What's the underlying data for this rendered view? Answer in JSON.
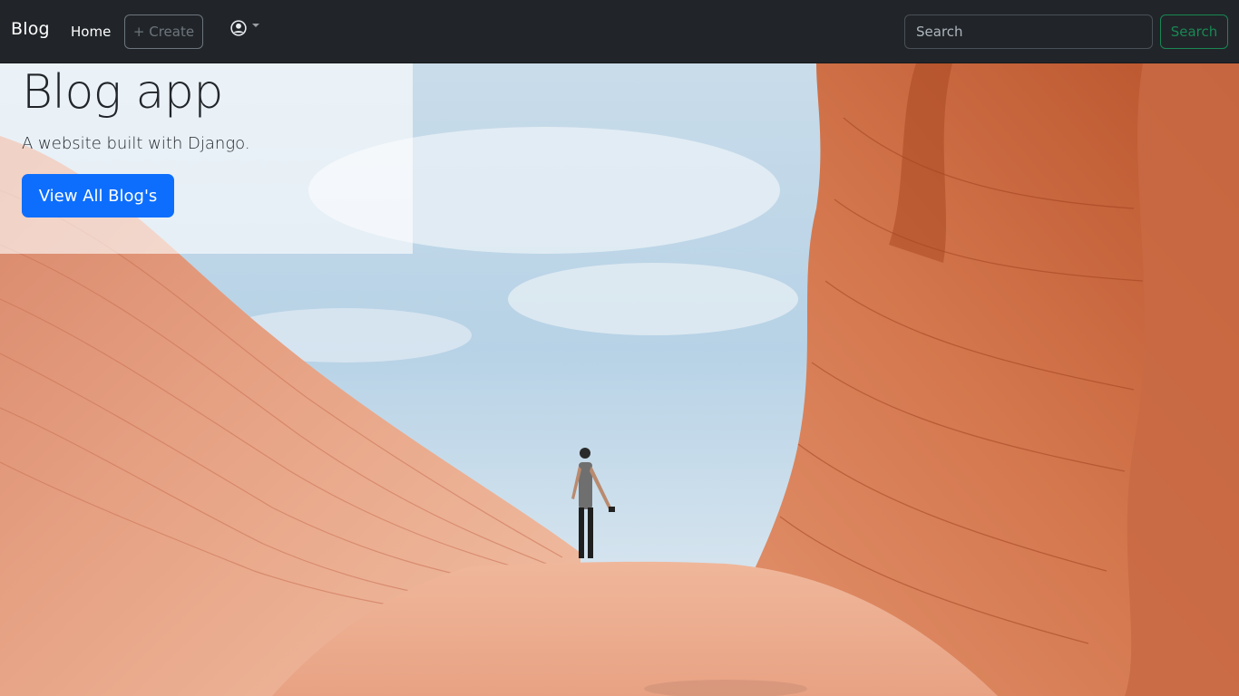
{
  "navbar": {
    "brand": "Blog",
    "home_label": "Home",
    "create_label": "+ Create",
    "user_icon": "person-circle-icon",
    "search": {
      "placeholder": "Search",
      "value": "",
      "button_label": "Search"
    }
  },
  "hero": {
    "title": "Blog app",
    "lead": "A website built with Django.",
    "cta_label": "View All Blog's"
  },
  "colors": {
    "navbar_bg": "#212529",
    "primary": "#0d6efd",
    "success": "#198754",
    "secondary": "#6c757d"
  }
}
